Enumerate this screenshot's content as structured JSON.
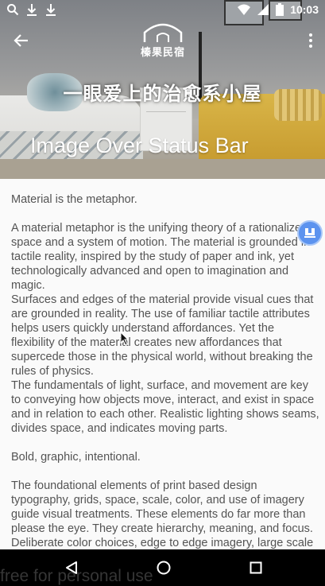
{
  "status_bar": {
    "time": "10:03",
    "icons_left": [
      "search-icon",
      "download-icon",
      "download-icon"
    ],
    "icons_right": [
      "wifi-icon",
      "signal-icon",
      "battery-icon"
    ]
  },
  "toolbar": {
    "back_icon": "arrow-back-icon",
    "more_icon": "more-vert-icon"
  },
  "logo": {
    "text": "榛果民宿"
  },
  "hero": {
    "slogan": "一眼爱上的治愈系小屋",
    "title": "Image Over Status Bar"
  },
  "content": {
    "paragraphs": [
      "Material is the metaphor.",
      " A material metaphor is the unifying theory of a rationalized space and a system of motion. The material is grounded in tactile reality, inspired by the study of paper and ink, yet  technologically advanced and open to imagination and magic.\n Surfaces and edges of the material provide visual cues that are grounded in reality. The  use of familiar tactile attributes helps users quickly understand affordances. Yet the  flexibility of the material creates new affordances that supercede those in the physical  world, without breaking the rules of physics.\n The fundamentals of light, surface, and movement are key to conveying how objects move,  interact, and exist in space and in relation to each other. Realistic lighting shows  seams, divides space, and indicates moving parts.",
      "Bold, graphic, intentional.",
      " The foundational elements of print based design typography, grids, space, scale, color,  and use of imagery guide visual treatments. These elements do far more than please the  eye. They create hierarchy, meaning, and focus. Deliberate color choices, edge to edge imagery, large scale typography, and intentional white space create a bold and graphic interface that immerse the user in the experience."
    ]
  },
  "fab": {
    "icon": "download-icon",
    "color": "#5c93ef"
  },
  "navbar": {
    "back_icon": "nav-back-icon",
    "home_icon": "nav-home-icon",
    "recents_icon": "nav-recents-icon"
  },
  "watermark": {
    "text": "free for personal use"
  }
}
